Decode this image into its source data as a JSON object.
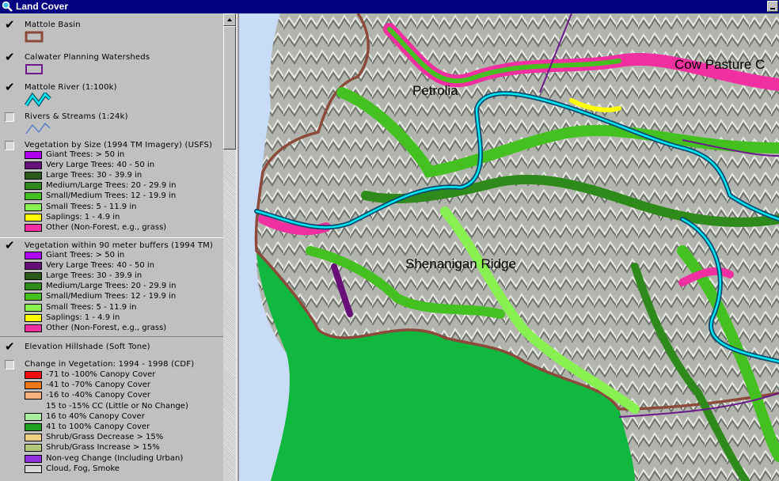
{
  "window": {
    "title": "Land Cover",
    "icon": "magnifier-globe-icon"
  },
  "legend": {
    "mattole_basin": {
      "label": "Mattole Basin",
      "checked": true,
      "color": "#8b4a3a"
    },
    "calwater": {
      "label": "Calwater Planning Watersheds",
      "checked": true,
      "color": "#6a1a8a"
    },
    "mattole_river": {
      "label": "Mattole River (1:100k)",
      "checked": true,
      "color": "#00d8e8"
    },
    "rivers_streams": {
      "label": "Rivers & Streams (1:24k)",
      "checked": false,
      "color": "#4a78c8"
    },
    "veg_size": {
      "label": "Vegetation by Size (1994 TM Imagery) (USFS)",
      "checked": false,
      "classes": [
        {
          "label": "Giant Trees: > 50 in",
          "color": "#b000f0"
        },
        {
          "label": "Very Large Trees: 40 - 50 in",
          "color": "#68107a"
        },
        {
          "label": "Large Trees: 30 - 39.9 in",
          "color": "#2a5a1a"
        },
        {
          "label": "Medium/Large Trees: 20 - 29.9 in",
          "color": "#2e8a1a"
        },
        {
          "label": "Small/Medium Trees: 12 - 19.9 in",
          "color": "#44c020"
        },
        {
          "label": "Small Trees: 5 - 11.9 in",
          "color": "#88f050"
        },
        {
          "label": "Saplings: 1 - 4.9 in",
          "color": "#ffff00"
        },
        {
          "label": "Other (Non-Forest, e.g., grass)",
          "color": "#f030a0"
        }
      ]
    },
    "veg_buffers": {
      "label": "Vegetation within 90 meter buffers (1994 TM)",
      "checked": true,
      "classes": [
        {
          "label": "Giant Trees: > 50 in",
          "color": "#b000f0"
        },
        {
          "label": "Very Large Trees: 40 - 50 in",
          "color": "#68107a"
        },
        {
          "label": "Large Trees: 30 - 39.9 in",
          "color": "#2a5a1a"
        },
        {
          "label": "Medium/Large Trees: 20 - 29.9 in",
          "color": "#2e8a1a"
        },
        {
          "label": "Small/Medium Trees: 12 - 19.9 in",
          "color": "#44c020"
        },
        {
          "label": "Small Trees: 5 - 11.9 in",
          "color": "#88f050"
        },
        {
          "label": "Saplings: 1 - 4.9 in",
          "color": "#ffff00"
        },
        {
          "label": "Other (Non-Forest, e.g., grass)",
          "color": "#f030a0"
        }
      ]
    },
    "hillshade": {
      "label": "Elevation Hillshade (Soft Tone)",
      "checked": true
    },
    "change": {
      "label": "Change in Vegetation: 1994 - 1998 (CDF)",
      "checked": false,
      "classes": [
        {
          "label": "-71 to -100% Canopy Cover",
          "color": "#f01010"
        },
        {
          "label": "-41 to -70% Canopy Cover",
          "color": "#f07818"
        },
        {
          "label": "-16 to -40% Canopy Cover",
          "color": "#f8b080"
        },
        {
          "label": "15 to -15% CC (Little or No Change)",
          "color": ""
        },
        {
          "label": "16 to 40% Canopy Cover",
          "color": "#a8f0a0"
        },
        {
          "label": "41 to 100% Canopy Cover",
          "color": "#20a020"
        },
        {
          "label": "Shrub/Grass Decrease > 15%",
          "color": "#f0d080"
        },
        {
          "label": "Shrub/Grass Increase > 15%",
          "color": "#b0c878"
        },
        {
          "label": "Non-veg Change (Including Urban)",
          "color": "#9030e0"
        },
        {
          "label": "Cloud, Fog, Smoke",
          "color": "#d8d8d8"
        }
      ]
    }
  },
  "map": {
    "labels": {
      "petrolia": "Petrolia",
      "cow_pasture": "Cow Pasture C",
      "shenanigan": "Shenanigan Ridge"
    },
    "colors": {
      "ocean": "#c8dcf8",
      "outside": "#10b840",
      "hillshade": "#a8aca4",
      "boundary": "#8b4a3a"
    }
  }
}
